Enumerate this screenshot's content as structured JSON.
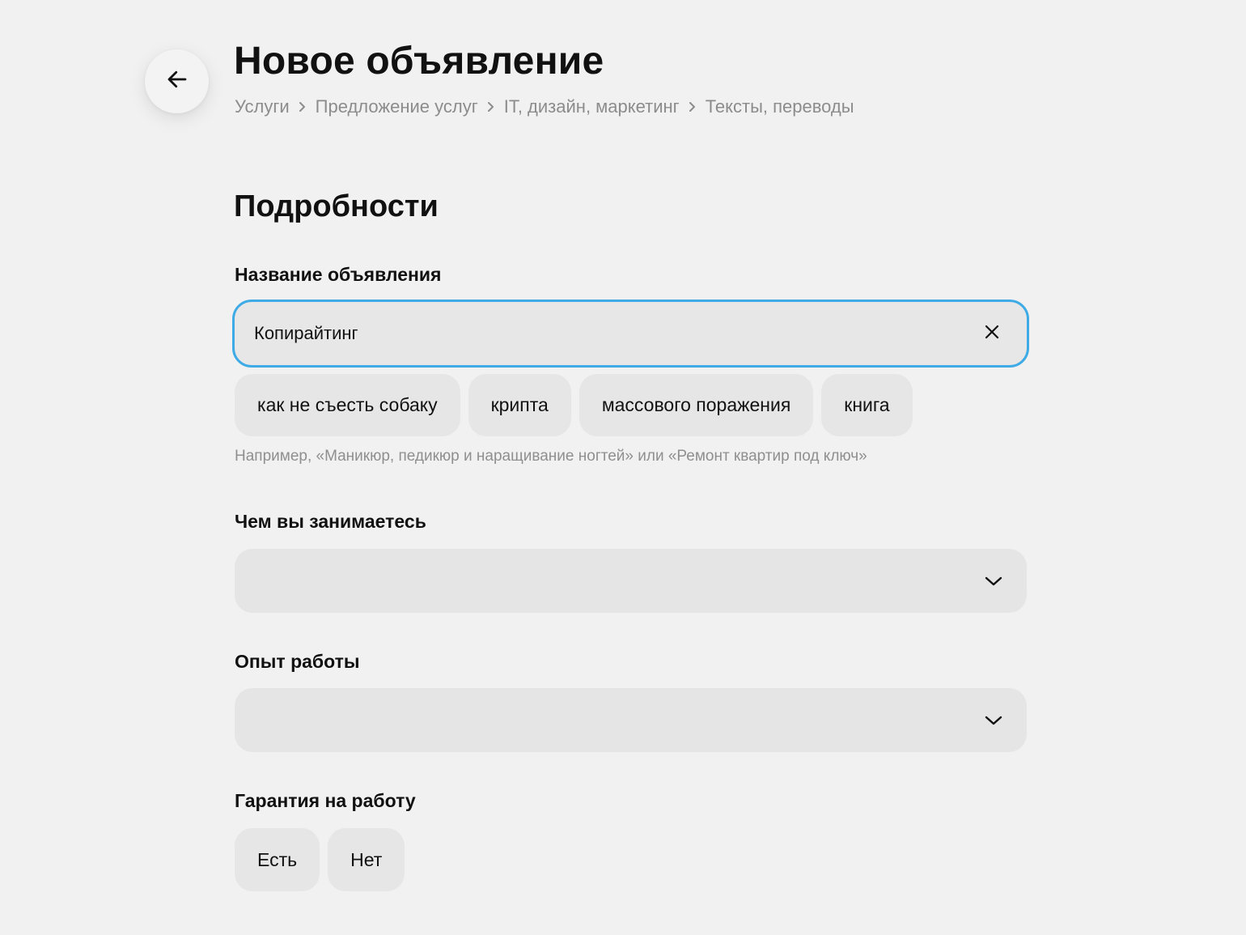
{
  "header": {
    "title": "Новое объявление",
    "back_icon": "arrow-left-icon",
    "breadcrumb": [
      "Услуги",
      "Предложение услуг",
      "IT, дизайн, маркетинг",
      "Тексты, переводы"
    ],
    "breadcrumb_separator_icon": "chevron-right-icon"
  },
  "details": {
    "section_title": "Подробности",
    "ad_title": {
      "label": "Название объявления",
      "value": "Копирайтинг",
      "clear_icon": "close-icon",
      "focus_color": "#3eabe6",
      "suggestions": [
        "как не съесть собаку",
        "крипта",
        "массового поражения",
        "книга"
      ],
      "hint": "Например, «Маникюр, педикюр и наращивание ногтей» или «Ремонт квартир под ключ»"
    },
    "occupation": {
      "label": "Чем вы занимаетесь",
      "value": "",
      "icon": "chevron-down-icon"
    },
    "experience": {
      "label": "Опыт работы",
      "value": "",
      "icon": "chevron-down-icon"
    },
    "warranty": {
      "label": "Гарантия на работу",
      "options": [
        "Есть",
        "Нет"
      ]
    }
  }
}
